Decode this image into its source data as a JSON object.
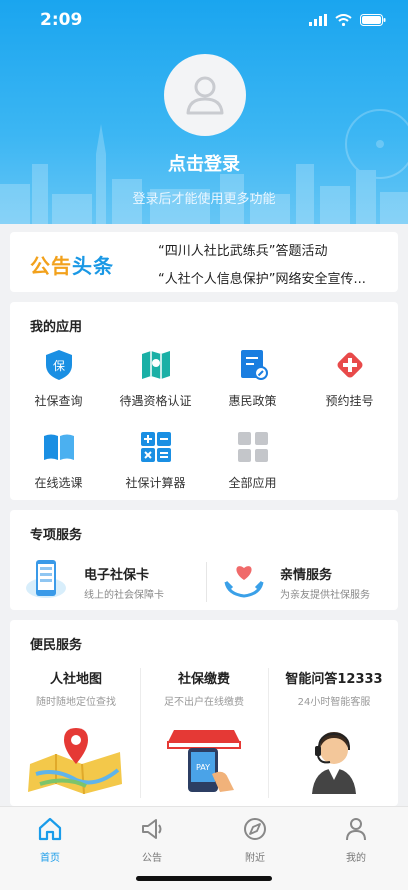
{
  "status_bar": {
    "time": "2:09"
  },
  "header": {
    "login_title": "点击登录",
    "login_subtitle": "登录后才能使用更多功能"
  },
  "notice": {
    "logo_part1": "公告",
    "logo_part2": "头条",
    "items": [
      "“四川人社比武练兵”答题活动",
      "“人社个人信息保护”网络安全宣传..."
    ]
  },
  "my_apps": {
    "title": "我的应用",
    "items": [
      {
        "label": "社保查询",
        "icon": "shield-icon"
      },
      {
        "label": "待遇资格认证",
        "icon": "map-certify-icon"
      },
      {
        "label": "惠民政策",
        "icon": "policy-doc-icon"
      },
      {
        "label": "预约挂号",
        "icon": "medical-cross-icon"
      },
      {
        "label": "在线选课",
        "icon": "book-icon"
      },
      {
        "label": "社保计算器",
        "icon": "calculator-icon"
      },
      {
        "label": "全部应用",
        "icon": "grid-icon"
      }
    ]
  },
  "special_services": {
    "title": "专项服务",
    "items": [
      {
        "title": "电子社保卡",
        "subtitle": "线上的社会保障卡",
        "icon": "phone-card-icon"
      },
      {
        "title": "亲情服务",
        "subtitle": "为亲友提供社保服务",
        "icon": "heart-hands-icon"
      }
    ]
  },
  "convenience": {
    "title": "便民服务",
    "items": [
      {
        "title": "人社地图",
        "subtitle": "随时随地定位查找",
        "icon": "map-pin-icon"
      },
      {
        "title": "社保缴费",
        "subtitle": "足不出户在线缴费",
        "icon": "pay-shop-icon"
      },
      {
        "title": "智能问答12333",
        "subtitle": "24小时智能客服",
        "icon": "customer-service-icon"
      }
    ]
  },
  "tabbar": {
    "items": [
      {
        "label": "首页",
        "icon": "home-icon",
        "active": true
      },
      {
        "label": "公告",
        "icon": "megaphone-icon",
        "active": false
      },
      {
        "label": "附近",
        "icon": "compass-icon",
        "active": false
      },
      {
        "label": "我的",
        "icon": "person-icon",
        "active": false
      }
    ]
  },
  "colors": {
    "primary": "#1a9cea",
    "accent_orange": "#f2a11c",
    "danger": "#e84a4a"
  }
}
